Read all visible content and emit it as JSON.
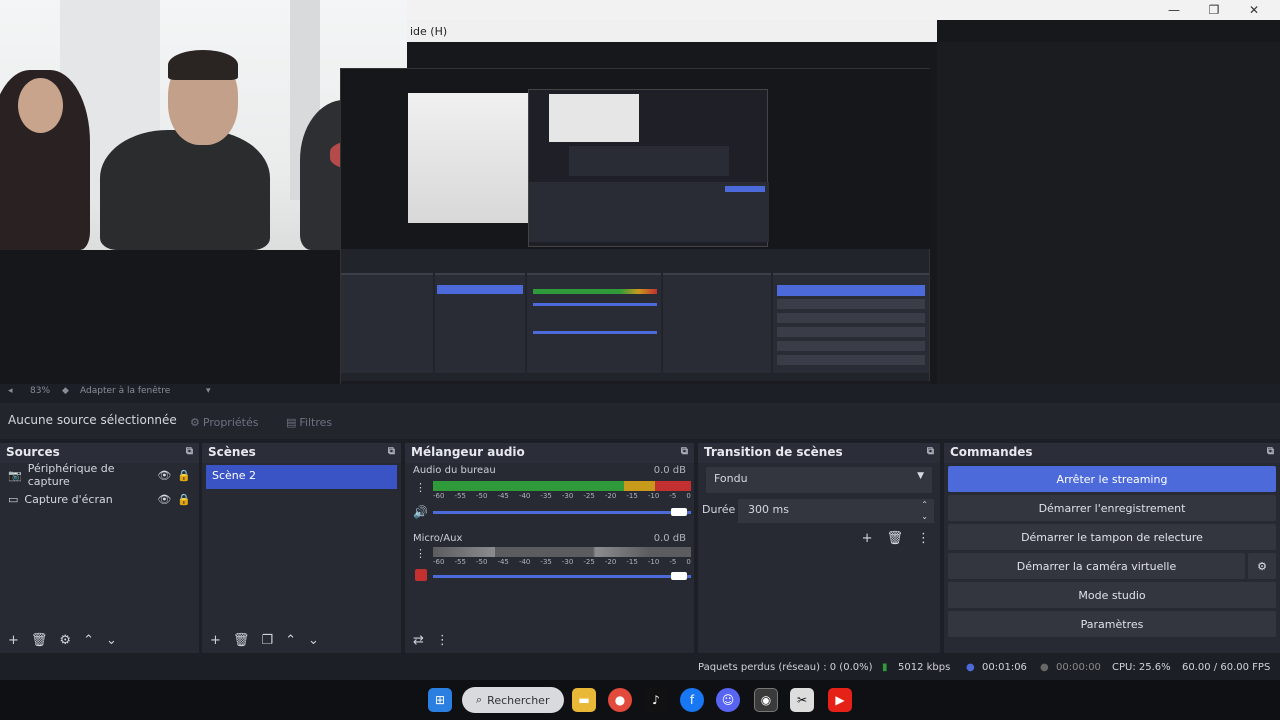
{
  "window": {
    "minimize": "—",
    "maximize": "❐",
    "close": "✕"
  },
  "nested_title": "ide (H)",
  "source_bar": {
    "canvas": "83%",
    "fit": "Adapter à la fenêtre"
  },
  "properties_bar": {
    "no_source": "Aucune source sélectionnée",
    "properties": "Propriétés",
    "filters": "Filtres"
  },
  "sources": {
    "title": "Sources",
    "items": [
      {
        "label": "Périphérique de capture"
      },
      {
        "label": "Capture d'écran"
      }
    ]
  },
  "scenes": {
    "title": "Scènes",
    "items": [
      {
        "label": "Scène 2"
      }
    ]
  },
  "mixer": {
    "title": "Mélangeur audio",
    "ticks": [
      "-60",
      "-55",
      "-50",
      "-45",
      "-40",
      "-35",
      "-30",
      "-25",
      "-20",
      "-15",
      "-10",
      "-5",
      "0"
    ],
    "channels": [
      {
        "name": "Audio du bureau",
        "db": "0.0 dB"
      },
      {
        "name": "Micro/Aux",
        "db": "0.0 dB"
      }
    ]
  },
  "transitions": {
    "title": "Transition de scènes",
    "type": "Fondu",
    "duration_label": "Durée",
    "duration_value": "300 ms"
  },
  "controls": {
    "title": "Commandes",
    "buttons": [
      "Arrêter le streaming",
      "Démarrer l'enregistrement",
      "Démarrer le tampon de relecture",
      "Démarrer la caméra virtuelle",
      "Mode studio",
      "Paramètres"
    ]
  },
  "status": {
    "dropped": "Paquets perdus (réseau) : 0 (0.0%)",
    "bitrate": "5012 kbps",
    "stream_time": "00:01:06",
    "rec_time": "00:00:00",
    "cpu": "CPU: 25.6%",
    "fps": "60.00 / 60.00 FPS"
  },
  "taskbar": {
    "search": "Rechercher"
  },
  "colors": {
    "accent": "#4c6ad9",
    "meter_green": "#2f9a3a",
    "meter_yellow": "#c79a1c",
    "meter_red": "#c2302f"
  }
}
